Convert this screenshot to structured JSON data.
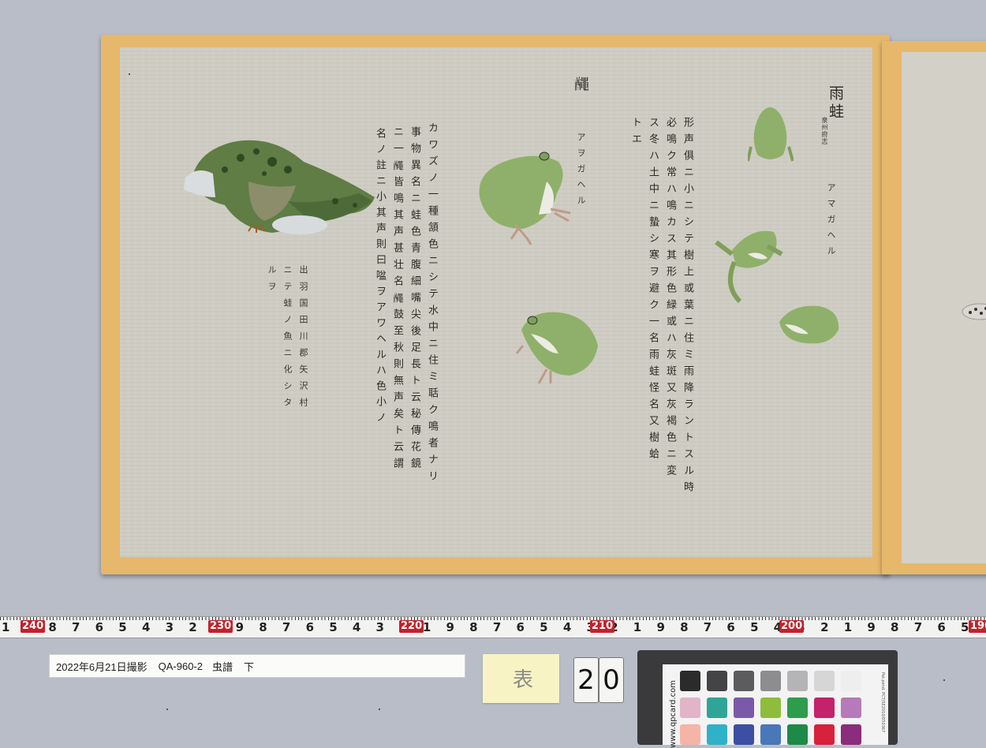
{
  "scroll": {
    "col_title_kaeru": "𪓰",
    "col_title_amagaeru": "雨蛙",
    "col_title_amagaeru_note": "泉州府志",
    "reading_aogaeru": "アヲガヘル",
    "reading_amagaeru": "アマガヘル",
    "text_col1": "カワズノ一種頷色ニシテ水中ニ住ミ聒ク鳴者ナリ",
    "text_col2": "事物異名ニ蛙色青腹細嘴尖後足長ト云秘傳花鏡",
    "text_col3": "ニ一𪓰皆鳴其声甚壮名𪓰鼓至秋則無声矣ト云謂",
    "text_col4": "名ノ註ニ小其声則曰㖹ヲアワヘルハ色小ノ",
    "text_col5": "形声俱ニ小ニシテ樹上或葉ニ住ミ雨降ラントスル時",
    "text_col6": "必鳴ク常ハ鳴カス其形色緑或ハ灰斑又灰褐色ニ変",
    "text_col7": "ス冬ハ土中ニ蟄シ寒ヲ避ク一名雨蛙怪名又樹蛤",
    "text_col8": "トエ",
    "note_col1": "出羽国田川郡矢沢村",
    "note_col2": "ニテ蛙ノ魚ニ化シタ",
    "note_col3": "ルヲ"
  },
  "ruler": {
    "digits": "1 9 8 7 6 5 4 3 2 1 9 8 7 6 5 4 3 2 1 9 8 7 6 5 4 3 2 1 9 8 7 6 5 4 3 2 1 9 8 7 6 5 4 3 2 1",
    "marks": [
      "240",
      "230",
      "220",
      "210",
      "200",
      "190"
    ]
  },
  "label": {
    "date": "2022年6月21日撮影",
    "code": "QA-960-2",
    "title": "虫譜",
    "volume": "下"
  },
  "sticky_note": "表",
  "page_number_digits": [
    "2",
    "0"
  ],
  "color_card": {
    "url": "www.qpcard.com",
    "code": "Pat.pend. PCT/SE2010/050367",
    "colors": [
      "#2b2b2b",
      "#444446",
      "#5c5c5e",
      "#8d8d8f",
      "#b4b4b6",
      "#d6d6d6",
      "#eeeeee",
      "#e2b4c8",
      "#2ea597",
      "#7a5aa8",
      "#8ebd3c",
      "#2d9c4d",
      "#c4226b",
      "#b67ab8",
      "#f4b4a6",
      "#2fb1c8",
      "#3c4fa4",
      "#4978b9",
      "#1e8a47",
      "#d9213c",
      "#8a2d7c"
    ]
  },
  "colors": {
    "board": "#e6b86b",
    "paper": "#cfcdc3",
    "frog_green": "#8fb06a",
    "ruler_mark": "#c8202a"
  }
}
